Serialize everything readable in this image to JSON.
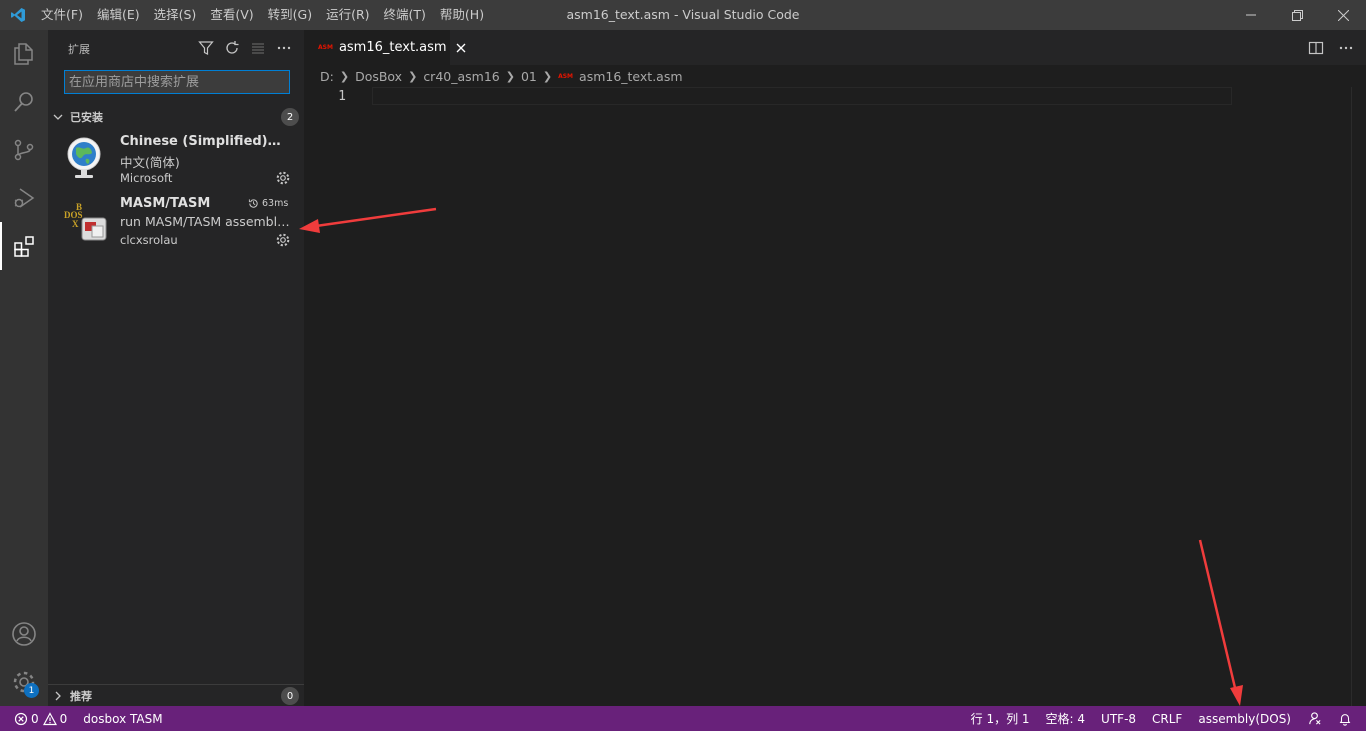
{
  "titlebar": {
    "window_title": "asm16_text.asm - Visual Studio Code",
    "menu": [
      "文件(F)",
      "编辑(E)",
      "选择(S)",
      "查看(V)",
      "转到(G)",
      "运行(R)",
      "终端(T)",
      "帮助(H)"
    ]
  },
  "activity": {
    "items": [
      "explorer-icon",
      "search-icon",
      "source-control-icon",
      "run-debug-icon",
      "extensions-icon"
    ],
    "bottom": [
      "accounts-icon",
      "manage-gear-icon"
    ],
    "manage_badge": "1"
  },
  "sidebar": {
    "title": "扩展",
    "search_placeholder": "在应用商店中搜索扩展",
    "installed": {
      "label": "已安装",
      "count": "2",
      "extensions": [
        {
          "name": "Chinese (Simplified) Language Pack for Visual Studio Code",
          "description": "中文(简体)",
          "publisher": "Microsoft"
        },
        {
          "name": "MASM/TASM",
          "description": "run MASM/TASM assembly in DOSBox",
          "publisher": "clcxsrolau",
          "activation_time": "63ms"
        }
      ]
    },
    "recommended": {
      "label": "推荐",
      "count": "0"
    }
  },
  "editor": {
    "tab": {
      "badge": "ASM",
      "label": "asm16_text.asm"
    },
    "breadcrumb": [
      "D:",
      "DosBox",
      "cr40_asm16",
      "01",
      "asm16_text.asm"
    ],
    "line_number": "1"
  },
  "statusbar": {
    "errors": "0",
    "warnings": "0",
    "dosbox": "dosbox TASM",
    "position": "行 1，列 1",
    "spaces": "空格: 4",
    "encoding": "UTF-8",
    "eol": "CRLF",
    "language": "assembly(DOS)"
  },
  "colors": {
    "statusbar_bg": "#68217a",
    "arrow": "#f03c3c",
    "accent_blue": "#007fd4"
  }
}
